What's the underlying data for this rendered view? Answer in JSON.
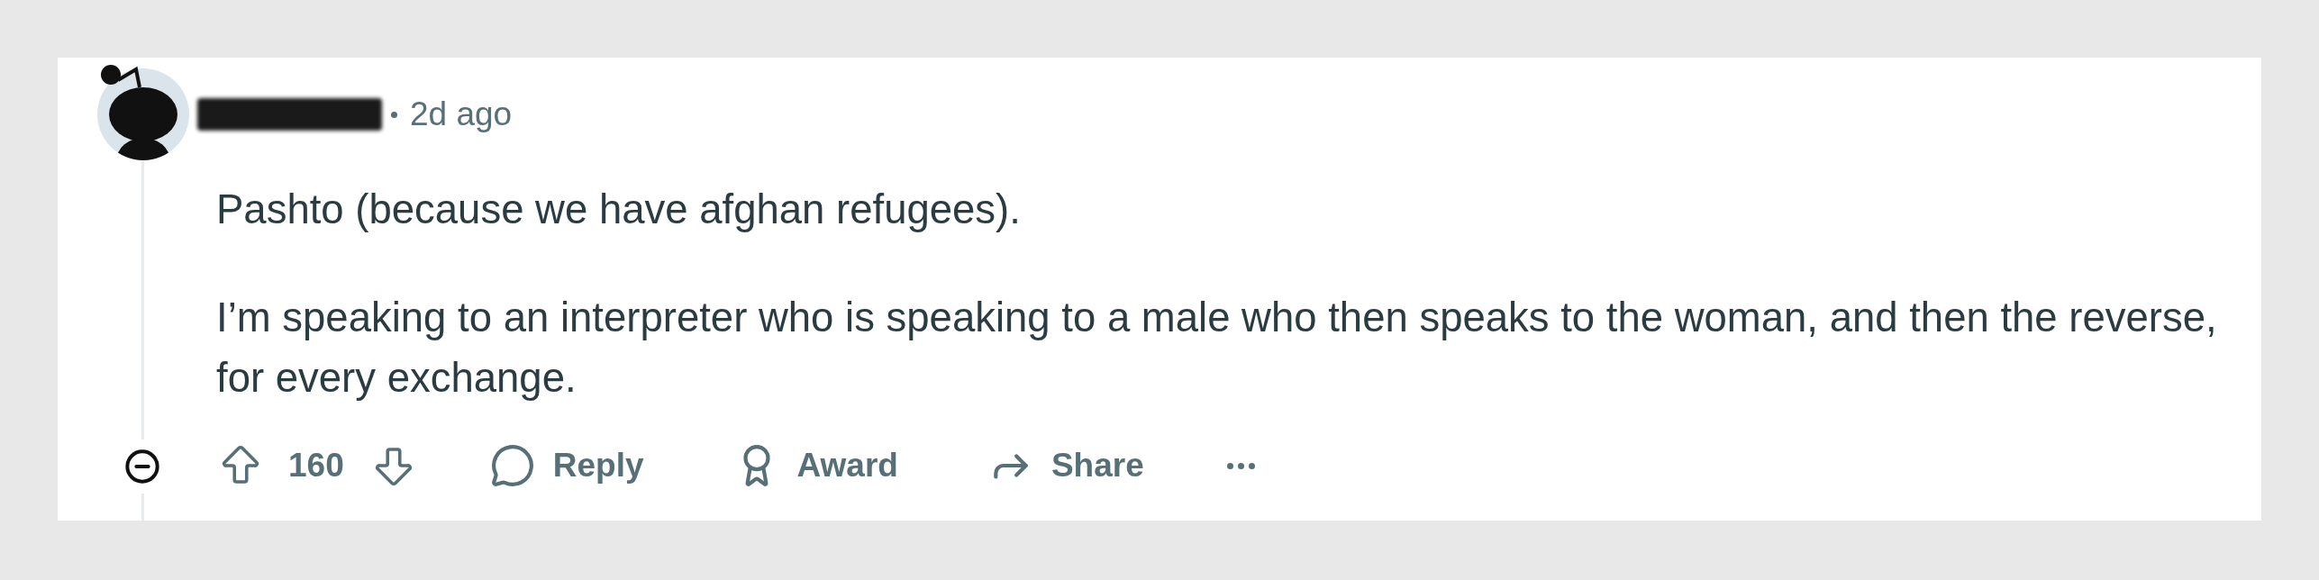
{
  "comment": {
    "author": {
      "redacted": true
    },
    "time": "2d ago",
    "paragraphs": [
      "Pashto (because we have afghan refugees).",
      "I’m speaking to an interpreter who is speaking to a male who then speaks to the woman, and then the reverse, for every exchange."
    ]
  },
  "actions": {
    "score": "160",
    "buttons": [
      {
        "kind": "reply",
        "label": "Reply"
      },
      {
        "kind": "award",
        "label": "Award"
      },
      {
        "kind": "share",
        "label": "Share"
      }
    ]
  }
}
